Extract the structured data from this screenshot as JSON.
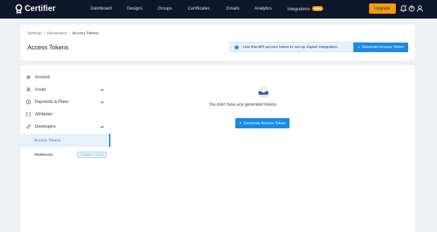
{
  "app": {
    "name": "Certifier"
  },
  "navbar": {
    "items": [
      {
        "label": "Dashboard"
      },
      {
        "label": "Designs"
      },
      {
        "label": "Groups"
      },
      {
        "label": "Certificates"
      },
      {
        "label": "Emails"
      },
      {
        "label": "Analytics"
      },
      {
        "label": "Integrations",
        "badge": "NEW"
      }
    ],
    "upgrade_label": "Upgrade",
    "icons": [
      "bell-icon",
      "help-icon",
      "user-icon"
    ],
    "colors": {
      "background": "#0f1629",
      "accent": "#f59e0b"
    }
  },
  "header": {
    "breadcrumb": [
      "Settings",
      "Developers",
      "Access Tokens"
    ],
    "title": "Access Tokens",
    "info_text": "Use this API access token to set up Zapier integration.",
    "generate_label": "Generate Access Token"
  },
  "sidebar": {
    "items": [
      {
        "label": "Account",
        "icon": "gear-icon"
      },
      {
        "label": "Issuer",
        "icon": "user-icon",
        "expandable": true
      },
      {
        "label": "Payments & Plans",
        "icon": "dollar-icon",
        "expandable": true
      },
      {
        "label": "Attributes",
        "icon": "brackets-icon"
      },
      {
        "label": "Developers",
        "icon": "link-icon",
        "expandable": true
      }
    ],
    "subitems": [
      {
        "label": "Access Tokens",
        "active": true
      },
      {
        "label": "Webhooks",
        "tag": "COMING SOON"
      }
    ]
  },
  "empty_state": {
    "message": "You don't have any generated tokens.",
    "generate_label": "Generate Access Token",
    "icon": "inbox-illustration-icon"
  },
  "colors": {
    "primary": "#1e88e5",
    "page_background": "#eef0f4"
  }
}
